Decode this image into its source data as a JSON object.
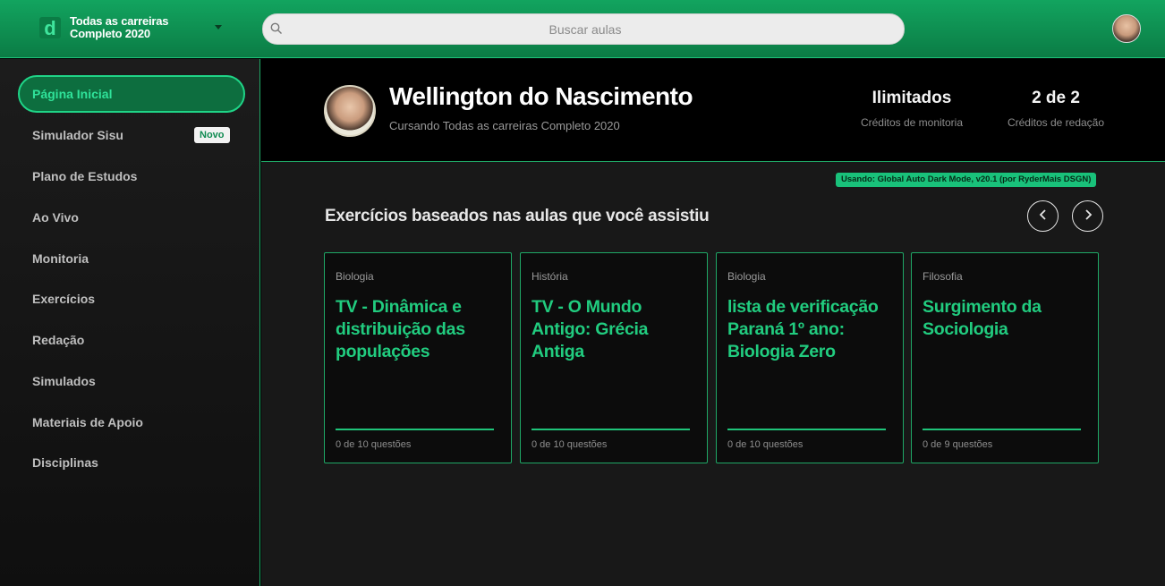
{
  "header": {
    "brand_line1": "Todas as carreiras",
    "brand_line2": "Completo 2020",
    "search_placeholder": "Buscar aulas",
    "brand_color": "#0e8f52",
    "accent_color": "#1fc47a"
  },
  "sidebar": {
    "items": [
      {
        "label": "Página Inicial",
        "active": true
      },
      {
        "label": "Simulador Sisu",
        "badge": "Novo"
      },
      {
        "label": "Plano de Estudos"
      },
      {
        "label": "Ao Vivo"
      },
      {
        "label": "Monitoria"
      },
      {
        "label": "Exercícios"
      },
      {
        "label": "Redação"
      },
      {
        "label": "Simulados"
      },
      {
        "label": "Materiais de Apoio"
      },
      {
        "label": "Disciplinas"
      }
    ]
  },
  "profile": {
    "name": "Wellington do Nascimento",
    "course": "Cursando Todas as carreiras Completo 2020",
    "stats": [
      {
        "value": "Ilimitados",
        "label": "Créditos de monitoria"
      },
      {
        "value": "2 de 2",
        "label": "Créditos de redação"
      }
    ]
  },
  "extension_tag": "Usando: Global Auto Dark Mode, v20.1 (por RyderMais DSGN)",
  "exercises": {
    "title": "Exercícios baseados nas aulas que você assistiu",
    "cards": [
      {
        "subject": "Biologia",
        "title": "TV - Dinâmica e distribuição das populações",
        "progress": "0 de 10 questões"
      },
      {
        "subject": "História",
        "title": "TV - O Mundo Antigo: Grécia Antiga",
        "progress": "0 de 10 questões"
      },
      {
        "subject": "Biologia",
        "title": "lista de verificação Paraná 1º ano: Biologia Zero",
        "progress": "0 de 10 questões"
      },
      {
        "subject": "Filosofia",
        "title": "Surgimento da Sociologia",
        "progress": "0 de 9 questões"
      }
    ]
  }
}
